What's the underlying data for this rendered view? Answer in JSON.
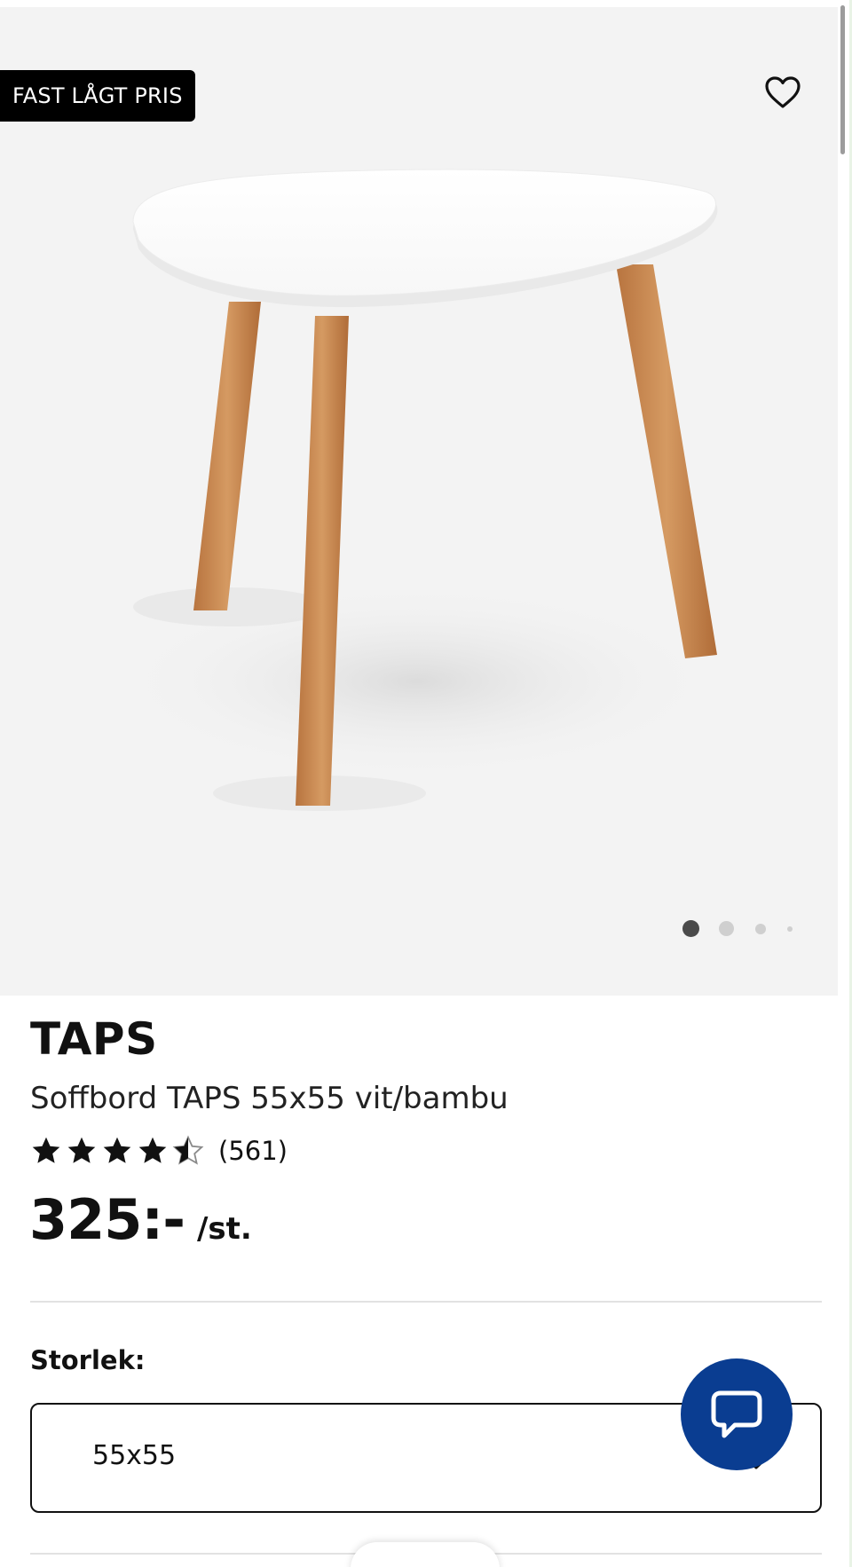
{
  "product": {
    "badge": "FAST LÅGT PRIS",
    "name": "TAPS",
    "description": "Soffbord TAPS 55x55 vit/bambu",
    "rating": {
      "stars": 4.5,
      "max": 5,
      "count_label": "(561)"
    },
    "price": {
      "value": "325:-",
      "unit": "/st."
    }
  },
  "gallery": {
    "slide_count": 4,
    "active_slide": 1
  },
  "size": {
    "label": "Storlek:",
    "selected": "55x55"
  },
  "icons": {
    "favorite": "heart-icon",
    "chat": "chat-bubble-icon",
    "dropdown": "chevron-down-icon",
    "rating": "star-icon"
  },
  "colors": {
    "badge_bg": "#000000",
    "chat_button": "#0a3d91",
    "hero_bg": "#f3f3f3",
    "bamboo": "#c98b52",
    "tabletop": "#ffffff"
  }
}
